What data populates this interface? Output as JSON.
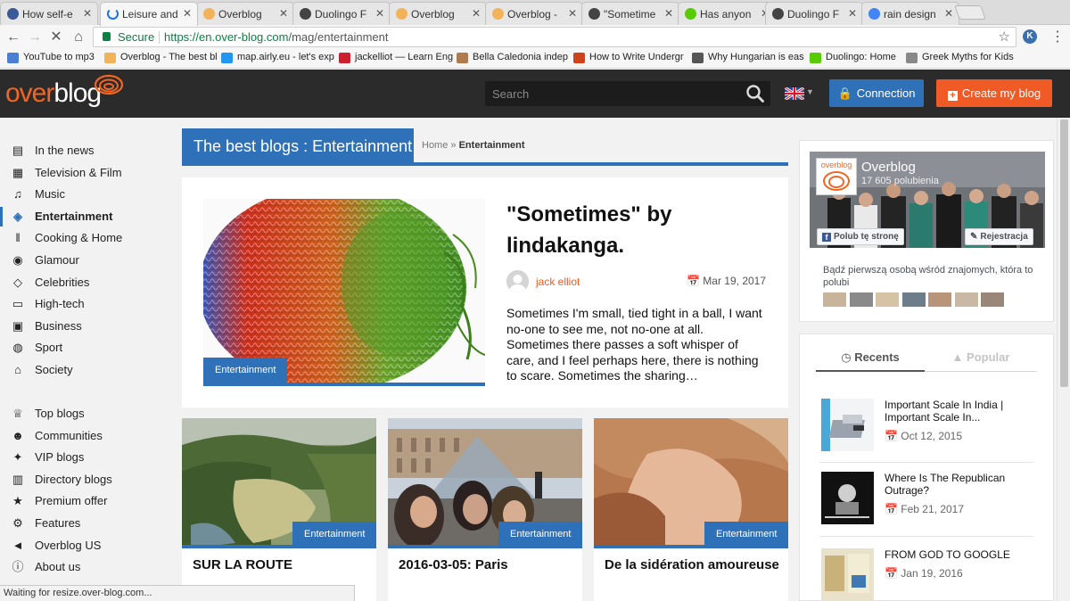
{
  "browser": {
    "tabs": [
      {
        "title": "How self-e",
        "icon_color": "#3b5998",
        "icon": "blog-favicon-icon"
      },
      {
        "title": "Leisure and",
        "icon_color": "#1a73e8",
        "icon": "loading-spinner-icon",
        "active": true
      },
      {
        "title": "Overblog",
        "icon_color": "#f2b35b",
        "icon": "overblog-favicon-icon"
      },
      {
        "title": "Duolingo F",
        "icon_color": "#444444",
        "icon": "duolingo-favicon-icon"
      },
      {
        "title": "Overblog",
        "icon_color": "#f2b35b",
        "icon": "overblog-favicon-icon"
      },
      {
        "title": "Overblog -",
        "icon_color": "#f2b35b",
        "icon": "overblog-favicon-icon"
      },
      {
        "title": "\"Sometime",
        "icon_color": "#444444",
        "icon": "duolingo-favicon-icon"
      },
      {
        "title": "Has anyon",
        "icon_color": "#58cc02",
        "icon": "duolingo-owl-icon"
      },
      {
        "title": "Duolingo F",
        "icon_color": "#444444",
        "icon": "duolingo-favicon-icon"
      },
      {
        "title": "rain design",
        "icon_color": "#4285f4",
        "icon": "google-favicon-icon"
      }
    ],
    "address": {
      "secure_label": "Secure",
      "url_host": "https://en.over-blog.com",
      "url_path": "/mag/entertainment"
    },
    "bookmarks": [
      {
        "label": "YouTube to mp3",
        "icon_color": "#4a7fd4"
      },
      {
        "label": "Overblog - The best bl",
        "icon_color": "#f2b35b"
      },
      {
        "label": "map.airly.eu - let's exp",
        "icon_color": "#2196f3"
      },
      {
        "label": "jackelliot — Learn Eng",
        "icon_color": "#cc1f2f"
      },
      {
        "label": "Bella Caledonia indep",
        "icon_color": "#b07a4f"
      },
      {
        "label": "How to Write Undergr",
        "icon_color": "#d0421b"
      },
      {
        "label": "Why Hungarian is eas",
        "icon_color": "#555555"
      },
      {
        "label": "Duolingo: Home",
        "icon_color": "#58cc02"
      },
      {
        "label": "Greek Myths for Kids",
        "icon_color": "#888888"
      }
    ],
    "status_text": "Waiting for resize.over-blog.com..."
  },
  "site": {
    "logo_part1": "over",
    "logo_part2": "blog",
    "search_placeholder": "Search",
    "connect_label": "Connection",
    "create_label": "Create my blog",
    "brand_orange": "#f05a24",
    "brand_blue": "#2f71b9"
  },
  "nav": {
    "items": [
      {
        "label": "In the news",
        "icon": "newspaper-icon"
      },
      {
        "label": "Television & Film",
        "icon": "film-icon"
      },
      {
        "label": "Music",
        "icon": "music-note-icon"
      },
      {
        "label": "Entertainment",
        "icon": "ticket-icon",
        "active": true
      },
      {
        "label": "Cooking & Home",
        "icon": "cutlery-icon"
      },
      {
        "label": "Glamour",
        "icon": "eye-icon"
      },
      {
        "label": "Celebrities",
        "icon": "diamond-icon"
      },
      {
        "label": "High-tech",
        "icon": "monitor-icon"
      },
      {
        "label": "Business",
        "icon": "briefcase-icon"
      },
      {
        "label": "Sport",
        "icon": "soccer-ball-icon"
      },
      {
        "label": "Society",
        "icon": "institution-icon"
      }
    ],
    "items2": [
      {
        "label": "Top blogs",
        "icon": "trophy-icon"
      },
      {
        "label": "Communities",
        "icon": "users-icon"
      },
      {
        "label": "VIP blogs",
        "icon": "vip-badge-icon"
      },
      {
        "label": "Directory blogs",
        "icon": "book-icon"
      },
      {
        "label": "Premium offer",
        "icon": "star-icon"
      },
      {
        "label": "Features",
        "icon": "gear-icon"
      },
      {
        "label": "Overblog US",
        "icon": "megaphone-icon"
      },
      {
        "label": "About us",
        "icon": "info-icon"
      }
    ]
  },
  "main": {
    "section_title": "The best blogs : Entertainment",
    "breadcrumb_home": "Home",
    "breadcrumb_sep": "»",
    "breadcrumb_current": "Entertainment",
    "featured": {
      "category": "Entertainment",
      "title": "\"Sometimes\" by lindakanga.",
      "author": "jack elliot",
      "date": "Mar 19, 2017",
      "excerpt": "Sometimes I'm small, tied tight in a ball, I want no-one to see me, not no-one at all. Sometimes there passes a soft whisper of care, and I feel perhaps here, there is nothing to scare. Sometimes the sharing…"
    },
    "cards": [
      {
        "category": "Entertainment",
        "title": "SUR LA ROUTE"
      },
      {
        "category": "Entertainment",
        "title": "2016-03-05: Paris"
      },
      {
        "category": "Entertainment",
        "title": "De la sidération amoureuse"
      }
    ]
  },
  "sidebar": {
    "facebook": {
      "page_name": "Overblog",
      "likes": "17 605 polubienia",
      "like_button": "Polub tę stronę",
      "register_button": "Rejestracja",
      "friends_text": "Bądź pierwszą osobą wśród znajomych, która to polubi",
      "logo_text": "overblog"
    },
    "tabs": {
      "recents": "Recents",
      "popular": "Popular"
    },
    "recents": [
      {
        "title": "Important Scale In India | Important Scale In...",
        "date": "Oct 12, 2015"
      },
      {
        "title": "Where Is The Republican Outrage?",
        "date": "Feb 21, 2017"
      },
      {
        "title": "FROM GOD TO GOOGLE",
        "date": "Jan 19, 2016"
      }
    ]
  }
}
